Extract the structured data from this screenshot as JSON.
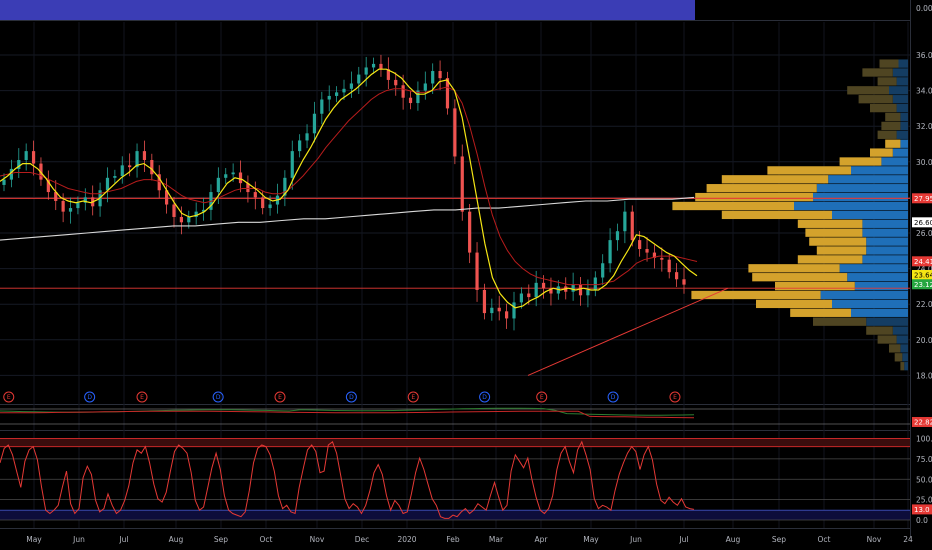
{
  "chart_data": {
    "type": "candlestick",
    "x_ticks": [
      "May",
      "Jun",
      "Jul",
      "Aug",
      "Sep",
      "Oct",
      "Nov",
      "Dec",
      "2020",
      "Feb",
      "Mar",
      "Apr",
      "May",
      "Jun",
      "Jul",
      "Aug",
      "Sep",
      "Oct",
      "Nov",
      "24"
    ],
    "y_ticks": [
      "36.00",
      "34.00",
      "32.00",
      "30.00",
      "28.00",
      "26.00",
      "24.00",
      "22.00",
      "20.00",
      "18.00"
    ],
    "top_pane_label": "0.00",
    "price_markers": [
      {
        "value": "27.95",
        "color": "#e53935"
      },
      {
        "value": "26.60",
        "color": "#ffffff"
      },
      {
        "value": "24.41",
        "color": "#e53935"
      },
      {
        "value": "23.64",
        "color": "#f5e614"
      },
      {
        "value": "23.12",
        "color": "#26a641"
      }
    ],
    "close_series": [
      29.0,
      29.6,
      30.1,
      30.6,
      29.9,
      29.0,
      28.3,
      27.8,
      27.2,
      27.4,
      27.7,
      28.0,
      27.5,
      28.4,
      29.1,
      29.2,
      29.8,
      29.7,
      30.6,
      30.1,
      29.3,
      28.4,
      27.6,
      26.9,
      26.6,
      26.9,
      27.2,
      27.3,
      28.3,
      29.1,
      29.3,
      29.4,
      28.8,
      28.3,
      28.0,
      27.4,
      27.6,
      28.1,
      29.1,
      30.6,
      31.2,
      31.6,
      32.7,
      33.5,
      33.7,
      33.9,
      34.1,
      34.4,
      34.9,
      35.3,
      35.5,
      35.2,
      34.6,
      34.3,
      33.6,
      33.3,
      34.0,
      34.4,
      35.1,
      34.7,
      33.0,
      30.3,
      27.2,
      24.9,
      22.8,
      21.5,
      21.8,
      21.6,
      21.2,
      22.1,
      22.6,
      22.4,
      23.2,
      22.9,
      22.6,
      23.0,
      22.7,
      23.1,
      22.5,
      22.8,
      23.5,
      24.3,
      25.6,
      26.1,
      27.2,
      25.6,
      25.1,
      24.9,
      24.6,
      24.5,
      23.8,
      23.4,
      23.1
    ],
    "ma_fast_series": [
      28.9,
      29.2,
      29.6,
      29.9,
      29.9,
      29.6,
      29.1,
      28.5,
      28.0,
      27.8,
      27.7,
      27.8,
      27.7,
      27.9,
      28.3,
      28.7,
      29.1,
      29.4,
      29.8,
      29.9,
      29.6,
      29.1,
      28.4,
      27.7,
      27.1,
      26.9,
      27.0,
      27.2,
      27.6,
      28.2,
      28.8,
      29.1,
      29.0,
      28.7,
      28.4,
      28.0,
      27.8,
      27.9,
      28.4,
      29.3,
      30.1,
      30.8,
      31.6,
      32.4,
      33.0,
      33.5,
      33.8,
      34.1,
      34.5,
      34.9,
      35.2,
      35.2,
      35.0,
      34.7,
      34.2,
      33.8,
      33.8,
      34.0,
      34.5,
      34.6,
      34.0,
      32.5,
      30.2,
      27.8,
      25.4,
      23.5,
      22.6,
      22.1,
      21.8,
      21.9,
      22.2,
      22.4,
      22.7,
      22.9,
      22.8,
      22.9,
      22.8,
      22.9,
      22.8,
      22.8,
      23.1,
      23.6,
      24.4,
      25.1,
      25.9,
      25.8,
      25.5,
      25.2,
      24.9,
      24.7,
      24.3,
      23.9,
      23.6
    ],
    "ma_mid_series": [
      29.2,
      29.3,
      29.4,
      29.4,
      29.4,
      29.3,
      29.1,
      28.9,
      28.7,
      28.5,
      28.4,
      28.3,
      28.2,
      28.2,
      28.3,
      28.4,
      28.5,
      28.7,
      28.9,
      29.0,
      29.0,
      28.9,
      28.7,
      28.4,
      28.1,
      27.9,
      27.8,
      27.7,
      27.8,
      28.0,
      28.2,
      28.4,
      28.5,
      28.5,
      28.5,
      28.3,
      28.2,
      28.2,
      28.4,
      28.8,
      29.2,
      29.7,
      30.2,
      30.8,
      31.3,
      31.8,
      32.3,
      32.7,
      33.1,
      33.5,
      33.8,
      34.0,
      34.1,
      34.1,
      34.0,
      33.9,
      33.9,
      34.0,
      34.1,
      34.2,
      34.0,
      33.3,
      32.0,
      30.4,
      28.6,
      27.0,
      25.8,
      25.0,
      24.4,
      24.0,
      23.7,
      23.5,
      23.4,
      23.3,
      23.2,
      23.1,
      23.1,
      23.1,
      23.1,
      23.1,
      23.2,
      23.3,
      23.6,
      23.9,
      24.3,
      24.5,
      24.6,
      24.7,
      24.7,
      24.7,
      24.6,
      24.5,
      24.4
    ],
    "ma_slow_series": [
      25.6,
      25.7,
      25.8,
      25.9,
      26.0,
      26.1,
      26.2,
      26.3,
      26.4,
      26.4,
      26.5,
      26.6,
      26.6,
      26.7,
      26.8,
      26.8,
      26.9,
      27.0,
      27.1,
      27.2,
      27.3,
      27.3,
      27.4,
      27.4,
      27.5,
      27.6,
      27.7,
      27.8,
      27.8,
      27.9,
      27.9,
      27.9,
      28.0
    ],
    "volume_profile_levels": [
      35.5,
      35.0,
      34.5,
      34.0,
      33.5,
      33.0,
      32.5,
      32.0,
      31.5,
      31.0,
      30.5,
      30.0,
      29.5,
      29.0,
      28.5,
      28.0,
      27.5,
      27.0,
      26.5,
      26.0,
      25.5,
      25.0,
      24.5,
      24.0,
      23.5,
      23.0,
      22.5,
      22.0,
      21.5,
      21.0,
      20.5,
      20.0,
      19.5,
      19.0,
      18.5
    ],
    "volume_profile_up": [
      10,
      16,
      10,
      22,
      18,
      14,
      8,
      10,
      10,
      8,
      12,
      22,
      44,
      56,
      58,
      62,
      64,
      58,
      34,
      30,
      30,
      26,
      34,
      48,
      50,
      42,
      68,
      40,
      32,
      28,
      14,
      10,
      6,
      4,
      2
    ],
    "volume_profile_down": [
      5,
      8,
      6,
      10,
      8,
      6,
      4,
      4,
      6,
      4,
      8,
      14,
      30,
      42,
      48,
      50,
      60,
      40,
      24,
      24,
      22,
      22,
      24,
      36,
      32,
      28,
      46,
      40,
      30,
      22,
      8,
      6,
      4,
      3,
      2
    ],
    "event_markers": [
      {
        "label": "E",
        "x": 1
      },
      {
        "label": "D",
        "x": 18
      },
      {
        "label": "E",
        "x": 29
      },
      {
        "label": "D",
        "x": 45
      },
      {
        "label": "E",
        "x": 58
      },
      {
        "label": "D",
        "x": 73
      },
      {
        "label": "E",
        "x": 86
      },
      {
        "label": "D",
        "x": 101
      },
      {
        "label": "E",
        "x": 113
      },
      {
        "label": "D",
        "x": 128
      },
      {
        "label": "E",
        "x": 141
      }
    ],
    "indicator_label": "22.82",
    "oscillator_ticks": [
      "100.0",
      "75.0",
      "50.0",
      "25.0",
      "0.0"
    ],
    "oscillator_label": "13.0",
    "oscillator_series": [
      70,
      88,
      92,
      80,
      60,
      40,
      72,
      86,
      90,
      74,
      40,
      12,
      8,
      12,
      18,
      40,
      60,
      20,
      8,
      14,
      52,
      66,
      56,
      24,
      10,
      14,
      32,
      18,
      8,
      12,
      24,
      42,
      70,
      86,
      82,
      90,
      70,
      44,
      26,
      22,
      34,
      60,
      84,
      92,
      88,
      82,
      58,
      24,
      12,
      16,
      40,
      64,
      82,
      62,
      30,
      12,
      8,
      6,
      4,
      10,
      36,
      70,
      88,
      92,
      90,
      80,
      60,
      30,
      14,
      18,
      10,
      8,
      40,
      64,
      86,
      92,
      84,
      58,
      60,
      92,
      96,
      82,
      54,
      26,
      14,
      20,
      16,
      8,
      18,
      36,
      58,
      68,
      56,
      30,
      12,
      24,
      18,
      8,
      10,
      32,
      58,
      76,
      62,
      44,
      26,
      18,
      4,
      2,
      2,
      6,
      4,
      10,
      14,
      8,
      12,
      20,
      16,
      12,
      30,
      46,
      28,
      12,
      18,
      60,
      80,
      72,
      64,
      76,
      50,
      28,
      12,
      8,
      14,
      30,
      62,
      82,
      90,
      72,
      58,
      86,
      96,
      80,
      62,
      26,
      14,
      18,
      16,
      12,
      36,
      56,
      70,
      82,
      90,
      84,
      62,
      80,
      90,
      74,
      44,
      24,
      20,
      28,
      22,
      18,
      26,
      16,
      14,
      13
    ]
  }
}
